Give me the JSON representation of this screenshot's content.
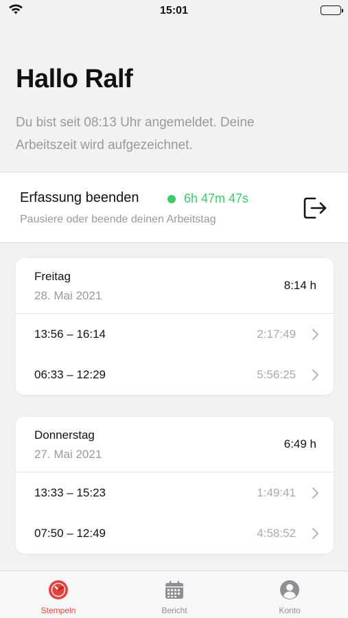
{
  "status_bar": {
    "time": "15:01",
    "wifi_icon": "wifi-icon",
    "battery_icon": "battery-icon"
  },
  "header": {
    "greeting": "Hallo Ralf",
    "subtitle": "Du bist seit 08:13 Uhr angemeldet. Deine Arbeitszeit wird aufgezeichnet."
  },
  "tracking": {
    "title": "Erfassung beenden",
    "timer": "6h 47m 47s",
    "hint": "Pausiere oder beende deinen Arbeitstag",
    "status_color": "#3cc96a",
    "action_icon": "logout-icon"
  },
  "days": [
    {
      "day": "Freitag",
      "date": "28. Mai 2021",
      "total": "8:14 h",
      "entries": [
        {
          "range": "13:56 – 16:14",
          "duration": "2:17:49"
        },
        {
          "range": "06:33 – 12:29",
          "duration": "5:56:25"
        }
      ]
    },
    {
      "day": "Donnerstag",
      "date": "27. Mai 2021",
      "total": "6:49 h",
      "entries": [
        {
          "range": "13:33 – 15:23",
          "duration": "1:49:41"
        },
        {
          "range": "07:50 – 12:49",
          "duration": "4:58:52"
        }
      ]
    }
  ],
  "tabbar": {
    "accent_color": "#e0443e",
    "tabs": [
      {
        "label": "Stempeln",
        "icon": "stopwatch-icon",
        "active": true
      },
      {
        "label": "Bericht",
        "icon": "calendar-icon",
        "active": false
      },
      {
        "label": "Konto",
        "icon": "account-icon",
        "active": false
      }
    ]
  }
}
